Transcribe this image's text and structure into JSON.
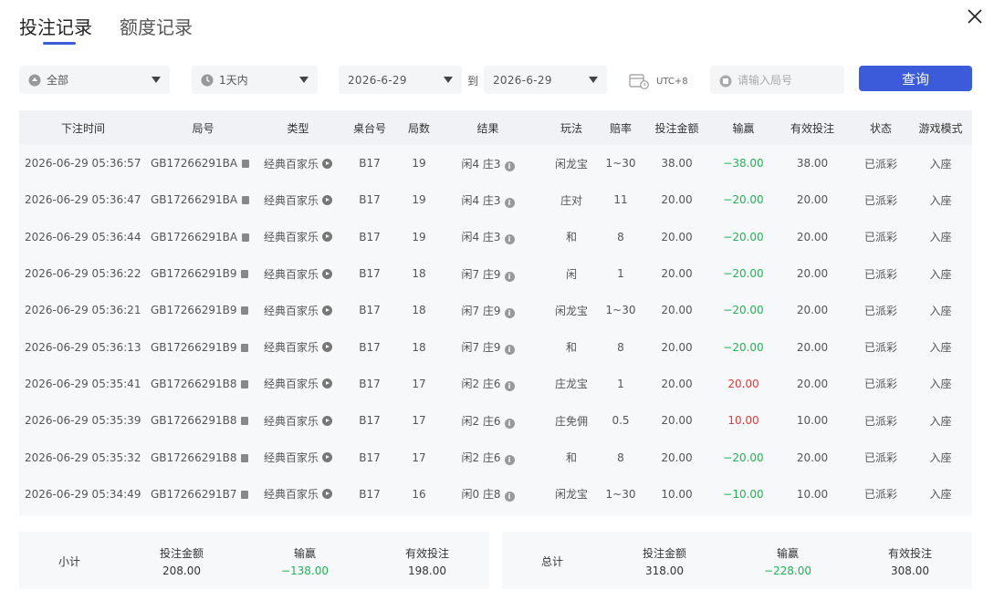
{
  "tabs": [
    {
      "label": "投注记录"
    },
    {
      "label": "额度记录"
    }
  ],
  "filters": {
    "type_value": "全部",
    "range_value": "1天内",
    "date_from": "2026-6-29",
    "to_label": "到",
    "date_to": "2026-6-29",
    "timezone": "UTC+8",
    "round_placeholder": "请输入局号",
    "query_label": "查询"
  },
  "table": {
    "columns": [
      "下注时间",
      "局号",
      "类型",
      "桌台号",
      "局数",
      "结果",
      "玩法",
      "赔率",
      "投注金额",
      "输赢",
      "有效投注",
      "状态",
      "游戏模式"
    ],
    "rows": [
      {
        "time": "2026-06-29 05:36:57",
        "round": "GB17266291BA",
        "type": "经典百家乐",
        "table": "B17",
        "shoe": "19",
        "result": "闲4 庄3",
        "play": "闲龙宝",
        "odds": "1~30",
        "bet": "38.00",
        "win": "−38.00",
        "win_sign": "neg",
        "valid": "38.00",
        "status": "已派彩",
        "mode": "入座"
      },
      {
        "time": "2026-06-29 05:36:47",
        "round": "GB17266291BA",
        "type": "经典百家乐",
        "table": "B17",
        "shoe": "19",
        "result": "闲4 庄3",
        "play": "庄对",
        "odds": "11",
        "bet": "20.00",
        "win": "−20.00",
        "win_sign": "neg",
        "valid": "20.00",
        "status": "已派彩",
        "mode": "入座"
      },
      {
        "time": "2026-06-29 05:36:44",
        "round": "GB17266291BA",
        "type": "经典百家乐",
        "table": "B17",
        "shoe": "19",
        "result": "闲4 庄3",
        "play": "和",
        "odds": "8",
        "bet": "20.00",
        "win": "−20.00",
        "win_sign": "neg",
        "valid": "20.00",
        "status": "已派彩",
        "mode": "入座"
      },
      {
        "time": "2026-06-29 05:36:22",
        "round": "GB17266291B9",
        "type": "经典百家乐",
        "table": "B17",
        "shoe": "18",
        "result": "闲7 庄9",
        "play": "闲",
        "odds": "1",
        "bet": "20.00",
        "win": "−20.00",
        "win_sign": "neg",
        "valid": "20.00",
        "status": "已派彩",
        "mode": "入座"
      },
      {
        "time": "2026-06-29 05:36:21",
        "round": "GB17266291B9",
        "type": "经典百家乐",
        "table": "B17",
        "shoe": "18",
        "result": "闲7 庄9",
        "play": "闲龙宝",
        "odds": "1~30",
        "bet": "20.00",
        "win": "−20.00",
        "win_sign": "neg",
        "valid": "20.00",
        "status": "已派彩",
        "mode": "入座"
      },
      {
        "time": "2026-06-29 05:36:13",
        "round": "GB17266291B9",
        "type": "经典百家乐",
        "table": "B17",
        "shoe": "18",
        "result": "闲7 庄9",
        "play": "和",
        "odds": "8",
        "bet": "20.00",
        "win": "−20.00",
        "win_sign": "neg",
        "valid": "20.00",
        "status": "已派彩",
        "mode": "入座"
      },
      {
        "time": "2026-06-29 05:35:41",
        "round": "GB17266291B8",
        "type": "经典百家乐",
        "table": "B17",
        "shoe": "17",
        "result": "闲2 庄6",
        "play": "庄龙宝",
        "odds": "1",
        "bet": "20.00",
        "win": "20.00",
        "win_sign": "pos",
        "valid": "20.00",
        "status": "已派彩",
        "mode": "入座"
      },
      {
        "time": "2026-06-29 05:35:39",
        "round": "GB17266291B8",
        "type": "经典百家乐",
        "table": "B17",
        "shoe": "17",
        "result": "闲2 庄6",
        "play": "庄免佣",
        "odds": "0.5",
        "bet": "20.00",
        "win": "10.00",
        "win_sign": "pos",
        "valid": "10.00",
        "status": "已派彩",
        "mode": "入座"
      },
      {
        "time": "2026-06-29 05:35:32",
        "round": "GB17266291B8",
        "type": "经典百家乐",
        "table": "B17",
        "shoe": "17",
        "result": "闲2 庄6",
        "play": "和",
        "odds": "8",
        "bet": "20.00",
        "win": "−20.00",
        "win_sign": "neg",
        "valid": "20.00",
        "status": "已派彩",
        "mode": "入座"
      },
      {
        "time": "2026-06-29 05:34:49",
        "round": "GB17266291B7",
        "type": "经典百家乐",
        "table": "B17",
        "shoe": "16",
        "result": "闲0 庄8",
        "play": "闲龙宝",
        "odds": "1~30",
        "bet": "10.00",
        "win": "−10.00",
        "win_sign": "neg",
        "valid": "10.00",
        "status": "已派彩",
        "mode": "入座"
      }
    ]
  },
  "subtotal": {
    "label": "小计",
    "bet_label": "投注金额",
    "bet": "208.00",
    "win_label": "输赢",
    "win": "−138.00",
    "valid_label": "有效投注",
    "valid": "198.00"
  },
  "total": {
    "label": "总计",
    "bet_label": "投注金额",
    "bet": "318.00",
    "win_label": "输赢",
    "win": "−228.00",
    "valid_label": "有效投注",
    "valid": "308.00"
  },
  "colors": {
    "accent": "#3b5bdb",
    "loss": "#21b454",
    "win": "#e53935"
  }
}
